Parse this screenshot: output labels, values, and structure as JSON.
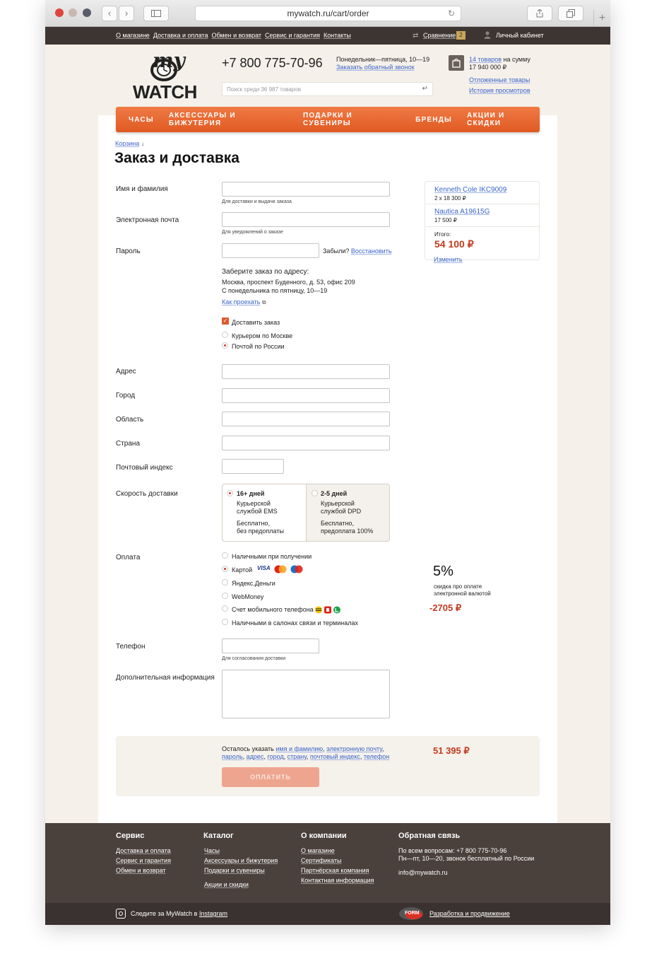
{
  "browser": {
    "url": "mywatch.ru/cart/order",
    "plus": "+"
  },
  "topbar": {
    "nav": [
      "О магазине",
      "Доставка и оплата",
      "Обмен и возврат",
      "Сервис и гарантия",
      "Контакты"
    ],
    "compare_label": "Сравнение",
    "compare_count": "2",
    "account_label": "Личный кабинет"
  },
  "header": {
    "logo_my": "my",
    "logo_watch": "WATCH",
    "phone": "+7 800 775-70-96",
    "hours": "Понедельник—пятница, 10—19",
    "callback": "Заказать обратный звонок",
    "search_placeholder": "Поиск среди 36 987 товаров",
    "cart_items": "14 товаров",
    "cart_sum_prefix": "на сумму",
    "cart_sum": "17 940 000 ₽",
    "deferred": "Отложенные товары",
    "history": "История просмотров"
  },
  "menu": [
    "ЧАСЫ",
    "АКСЕССУАРЫ И БИЖУТЕРИЯ",
    "ПОДАРКИ И СУВЕНИРЫ",
    "БРЕНДЫ",
    "АКЦИИ И СКИДКИ"
  ],
  "breadcrumb": "Корзина",
  "page_title": "Заказ и доставка",
  "form": {
    "name_label": "Имя и фамилия",
    "name_hint": "Для доставки и выдачи заказа",
    "email_label": "Электронная почта",
    "email_hint": "Для уведомлений о заказе",
    "password_label": "Пароль",
    "forgot": "Забыли?",
    "restore": "Восстановить",
    "pickup_title": "Заберите заказ по адресу:",
    "pickup_address": "Москва, проспект Буденного, д. 53, офис 209",
    "pickup_hours": "С понедельника по пятницу, 10—19",
    "directions": "Как проехать",
    "deliver_label": "Доставить заказ",
    "courier": "Курьером по Москве",
    "post": "Почтой по России",
    "address_label": "Адрес",
    "city_label": "Город",
    "region_label": "Область",
    "country_label": "Страна",
    "zip_label": "Почтовый индекс",
    "speed_label": "Скорость доставки",
    "speed_options": [
      {
        "title": "16+ дней",
        "desc1": "Курьерской",
        "desc2": "службой EMS",
        "cost1": "Бесплатно,",
        "cost2": "без предоплаты"
      },
      {
        "title": "2-5 дней",
        "desc1": "Курьерской",
        "desc2": "службой DPD",
        "cost1": "Бесплатно,",
        "cost2": "предоплата 100%"
      }
    ],
    "payment_label": "Оплата",
    "payment_options": [
      "Наличными при получении",
      "Картой",
      "Яндекс.Деньги",
      "WebMoney",
      "Счет мобильного телефона",
      "Наличными в салонах связи и терминалах"
    ],
    "card_logos": [
      "VISA"
    ],
    "discount_pct": "5%",
    "discount_text1": "скидка про оплате",
    "discount_text2": "электронной валютой",
    "discount_amount": "-2705 ₽",
    "phone_label": "Телефон",
    "phone_hint": "Для согласования доставки",
    "extra_label": "Дополнительная информация"
  },
  "summary": {
    "items": [
      {
        "name": "Kenneth Cole IKC9009",
        "qty": "2 x 18 300 ₽"
      },
      {
        "name": "Nautica A19615G",
        "qty": "17 500 ₽"
      }
    ],
    "total_label": "Итого:",
    "total": "54 100 ₽",
    "change": "Изменить"
  },
  "checkout": {
    "remaining_prefix": "Осталось указать",
    "remaining_fields": [
      "имя и фамилию",
      "электронную почту",
      "пароль",
      "адрес",
      "город",
      "страну",
      "почтовый индекс",
      "телефон"
    ],
    "total": "51 395 ₽",
    "pay_button": "ОПЛАТИТЬ"
  },
  "footer": {
    "service_title": "Сервис",
    "service_items": [
      "Доставка и оплата",
      "Сервис и гарантия",
      "Обмен и возврат"
    ],
    "catalog_title": "Каталог",
    "catalog_items": [
      "Часы",
      "Аксессуары и бижутерия",
      "Подарки и сувениры",
      "Акции и скидки"
    ],
    "company_title": "О компании",
    "company_items": [
      "О магазине",
      "Сертификаты",
      "Партнёрская компания",
      "Контактная информация"
    ],
    "feedback_title": "Обратная связь",
    "feedback_line1": "По всем вопросам: +7 800 775-70-96",
    "feedback_line2": "Пн—пт, 10—20, звонок бесплатный по России",
    "email": "info@mywatch.ru",
    "instagram_prefix": "Следите за MyWatch в",
    "instagram_link": "Instagram",
    "dev_logo": "FORM",
    "dev_link": "Разработка и продвижение"
  },
  "colors": {
    "accent": "#e8642c",
    "price": "#c23a1f",
    "link": "#3a64c8",
    "dark": "#3d3532"
  }
}
